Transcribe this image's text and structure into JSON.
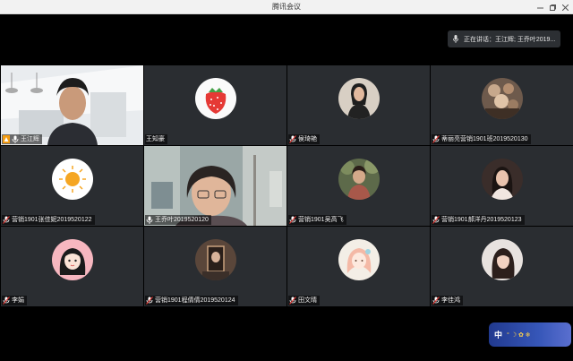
{
  "window": {
    "title": "腾讯会议"
  },
  "speaking": {
    "text": "正在讲话：王江辉; 王乔叶2019..."
  },
  "participants": [
    {
      "name": "王江辉",
      "host": true,
      "mic": "on"
    },
    {
      "name": "王知豪",
      "host": false,
      "mic": "none"
    },
    {
      "name": "侯琦艳",
      "host": false,
      "mic": "off"
    },
    {
      "name": "蒂丽亮营销1901班2019520130",
      "host": false,
      "mic": "off"
    },
    {
      "name": "营销1901张佳妮2019520122",
      "host": false,
      "mic": "off"
    },
    {
      "name": "王乔叶2019520120",
      "host": false,
      "mic": "on"
    },
    {
      "name": "营销1901吴高飞",
      "host": false,
      "mic": "off"
    },
    {
      "name": "营销1901郝洋丹2019520123",
      "host": false,
      "mic": "off"
    },
    {
      "name": "李娟",
      "host": false,
      "mic": "off"
    },
    {
      "name": "营销1901程倩倩2019520124",
      "host": false,
      "mic": "off"
    },
    {
      "name": "田文晴",
      "host": false,
      "mic": "off"
    },
    {
      "name": "李佳鸿",
      "host": false,
      "mic": "off"
    }
  ],
  "ime": {
    "lang": "中",
    "glyphs": "° ☽ ✿ ❄"
  },
  "colors": {
    "active_border": "#4caf50",
    "tile_bg": "#2a2d31",
    "host_badge": "#f39c12"
  }
}
